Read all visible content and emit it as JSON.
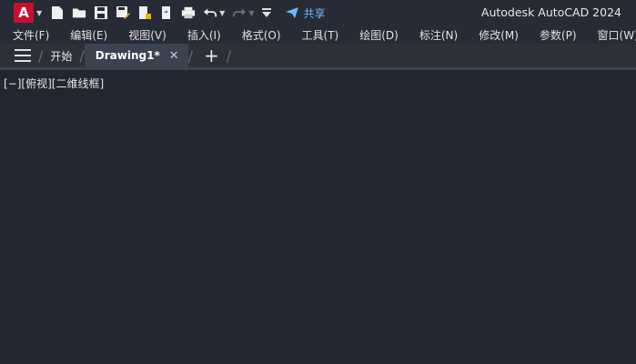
{
  "app": {
    "logo_letter": "A",
    "title": "Autodesk AutoCAD 2024"
  },
  "qat": {
    "icons": [
      "new-file-icon",
      "open-folder-icon",
      "save-icon",
      "save-as-icon",
      "open-from-web-icon",
      "save-to-web-icon",
      "print-icon",
      "undo-icon",
      "redo-icon",
      "customize-qat-icon"
    ],
    "share_label": "共享"
  },
  "menu": {
    "items": [
      "文件(F)",
      "编辑(E)",
      "视图(V)",
      "插入(I)",
      "格式(O)",
      "工具(T)",
      "绘图(D)",
      "标注(N)",
      "修改(M)",
      "参数(P)",
      "窗口(W)"
    ]
  },
  "tabs": {
    "start_label": "开始",
    "active_label": "Drawing1*",
    "close_glyph": "✕",
    "add_glyph": "+"
  },
  "viewport": {
    "controls_label": "[−][俯视][二维线框]"
  },
  "colors": {
    "accent": "#6fb8ff",
    "logo_bg": "#c8102e",
    "canvas": "#212630"
  }
}
